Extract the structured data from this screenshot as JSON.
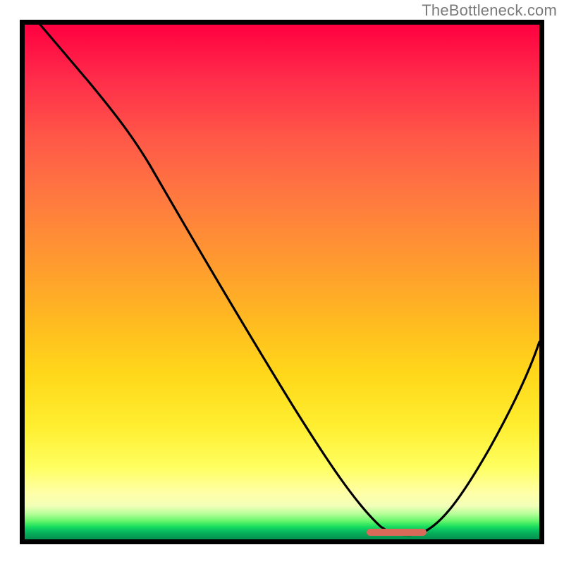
{
  "watermark": "TheBottleneck.com",
  "chart_data": {
    "type": "line",
    "title": "",
    "xlabel": "",
    "ylabel": "",
    "xlim": [
      0,
      100
    ],
    "ylim": [
      0,
      100
    ],
    "grid": false,
    "legend": false,
    "description": "Bottleneck curve over heatmap gradient (red=high bottleneck at top, green=low at bottom). Curve starts at top-left, descends steeply, reaches minimum around x≈70–78 (thick salmon marker at bottom), then rises toward right edge.",
    "series": [
      {
        "name": "bottleneck-curve",
        "x": [
          3,
          10,
          18,
          24,
          30,
          38,
          46,
          54,
          60,
          65,
          69,
          73,
          78,
          83,
          88,
          93,
          98,
          100
        ],
        "y": [
          100,
          92,
          82,
          74,
          68,
          58,
          47,
          36,
          27,
          18,
          10,
          3,
          1,
          6,
          15,
          26,
          38,
          44
        ]
      }
    ],
    "optimal_marker": {
      "x_start": 67,
      "x_end": 79,
      "y": 1.5
    },
    "gradient_stops": [
      {
        "pct": 0,
        "color": "#ff0040"
      },
      {
        "pct": 50,
        "color": "#ffaa20"
      },
      {
        "pct": 85,
        "color": "#ffff60"
      },
      {
        "pct": 97,
        "color": "#20d860"
      },
      {
        "pct": 100,
        "color": "#049050"
      }
    ]
  }
}
